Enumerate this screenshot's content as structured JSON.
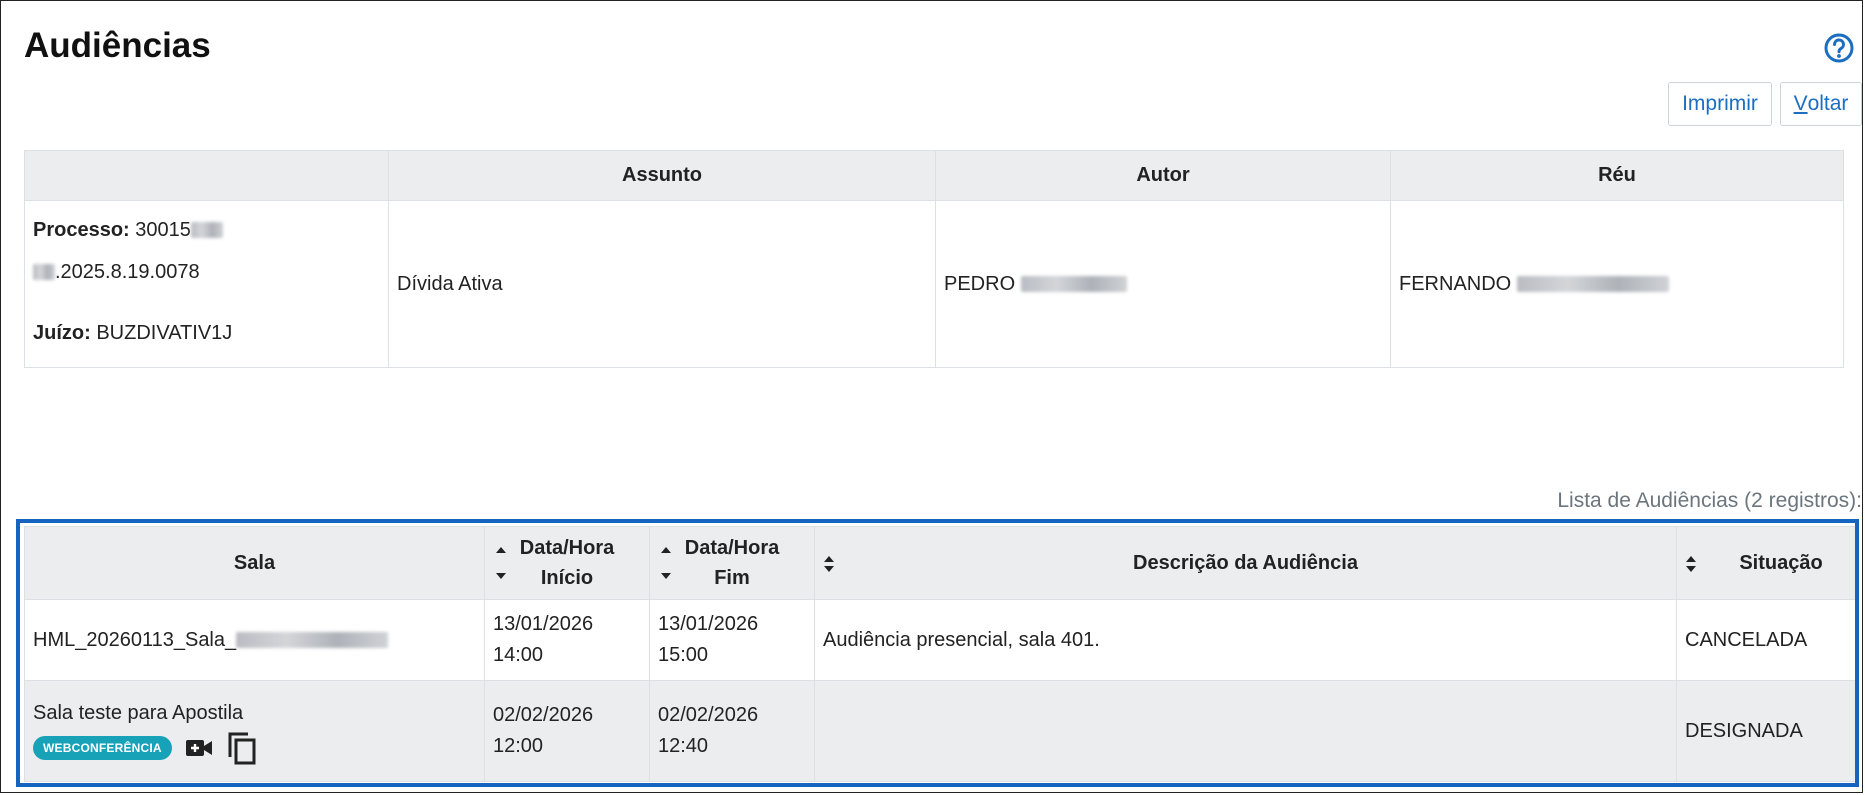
{
  "page": {
    "title": "Audiências"
  },
  "toolbar": {
    "print_label": "Imprimir",
    "back_label_first": "V",
    "back_label_rest": "oltar"
  },
  "process_table": {
    "headers": {
      "blank": "",
      "assunto": "Assunto",
      "autor": "Autor",
      "reu": "Réu"
    },
    "processo_label": "Processo:",
    "processo_prefix": "30015",
    "processo_suffix": ".2025.8.19.0078",
    "juizo_label": "Juízo:",
    "juizo_value": "BUZDIVATIV1J",
    "assunto": "Dívida Ativa",
    "autor": "PEDRO",
    "reu": "FERNANDO"
  },
  "hearings": {
    "caption": "Lista de Audiências (2 registros):",
    "headers": {
      "sala": "Sala",
      "inicio_line1": "Data/Hora",
      "inicio_line2": "Início",
      "fim_line1": "Data/Hora",
      "fim_line2": "Fim",
      "descricao": "Descrição da Audiência",
      "situacao": "Situação"
    },
    "rows": [
      {
        "sala": "HML_20260113_Sala_",
        "inicio_date": "13/01/2026",
        "inicio_time": "14:00",
        "fim_date": "13/01/2026",
        "fim_time": "15:00",
        "descricao": "Audiência presencial, sala 401.",
        "situacao": "CANCELADA"
      },
      {
        "sala": "Sala teste para Apostila",
        "badge": "WEBCONFERÊNCIA",
        "inicio_date": "02/02/2026",
        "inicio_time": "12:00",
        "fim_date": "02/02/2026",
        "fim_time": "12:40",
        "descricao": "",
        "situacao": "DESIGNADA"
      }
    ]
  },
  "colors": {
    "link": "#1b6ec2",
    "highlight": "#1565c0",
    "badge": "#17a2b8",
    "header_bg": "#ebedef"
  },
  "icons": [
    "help-icon",
    "video-camera-icon",
    "copy-icon",
    "sort-asc-icon",
    "sort-desc-icon",
    "sort-both-icon"
  ]
}
